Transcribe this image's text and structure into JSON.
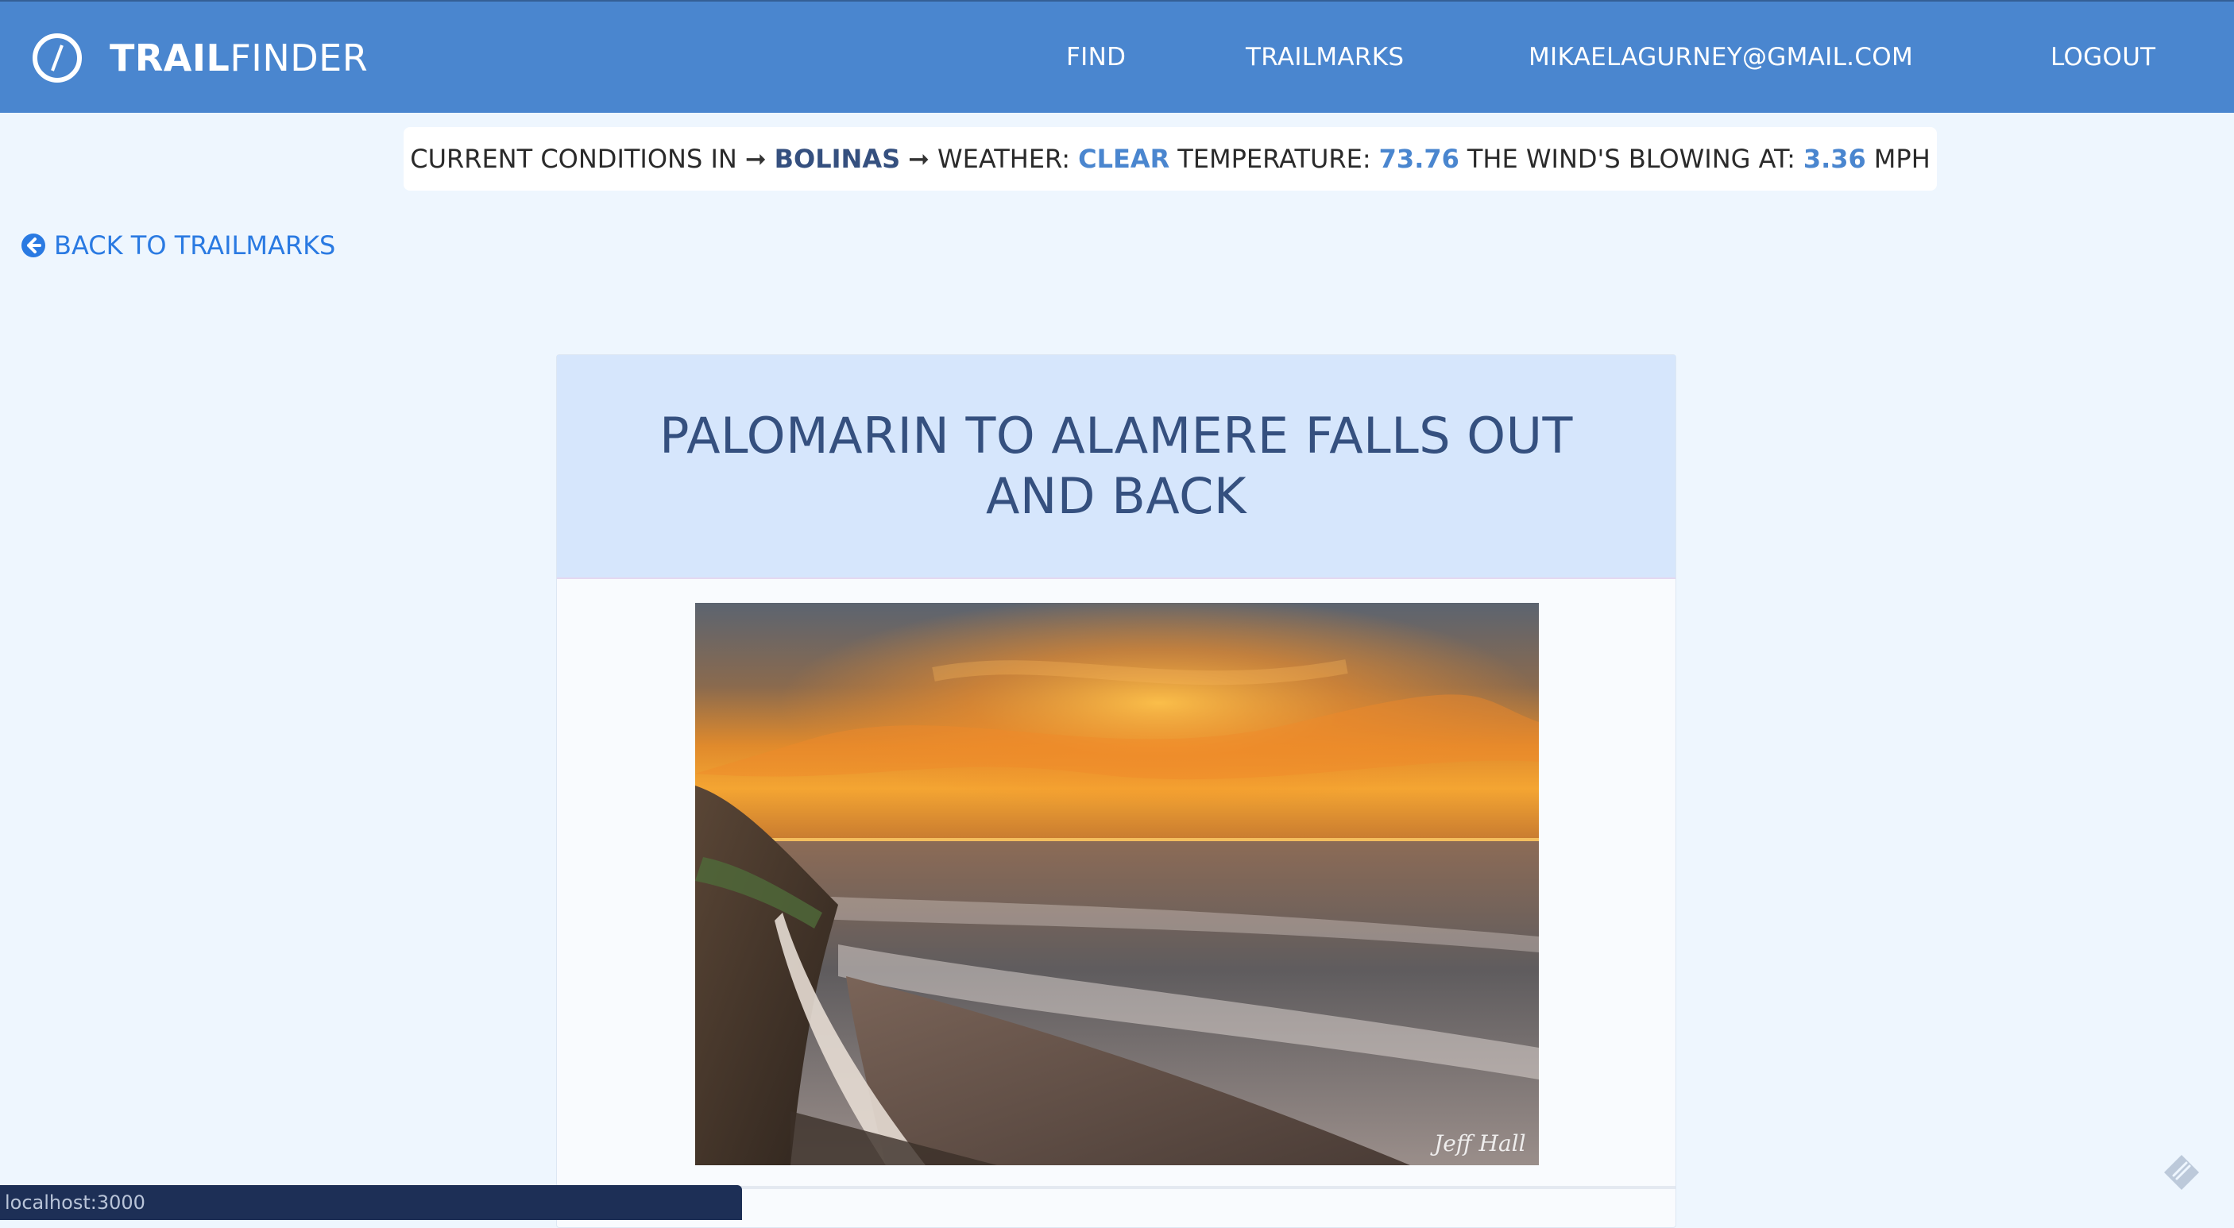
{
  "brand": {
    "strong": "TRAIL",
    "light": "FINDER"
  },
  "nav": {
    "find": "FIND",
    "trailmarks": "TRAILMARKS",
    "email": "MIKAELAGURNEY@GMAIL.COM",
    "logout": "LOGOUT"
  },
  "conditions": {
    "prefix": "CURRENT CONDITIONS IN",
    "arrow": "➞",
    "city": "BOLINAS",
    "weather_label": "WEATHER:",
    "weather_value": "CLEAR",
    "temp_label": "TEMPERATURE:",
    "temp_value": "73.76",
    "wind_label": "THE WIND'S BLOWING AT:",
    "wind_value": "3.36",
    "wind_unit": "MPH"
  },
  "back_link": "BACK TO TRAILMARKS",
  "trail": {
    "title": "PALOMARIN TO ALAMERE FALLS OUT AND BACK",
    "photo_credit": "Jeff Hall"
  },
  "status_bar": "localhost:3000",
  "colors": {
    "navbar": "#4a86cf",
    "page_bg": "#eef6fe",
    "card_header": "#d6e6fc",
    "title_text": "#35507f",
    "link": "#2a7ae2"
  },
  "icons": {
    "brand": "compass-icon",
    "back": "arrow-circle-left-icon",
    "corner": "feather-icon"
  }
}
